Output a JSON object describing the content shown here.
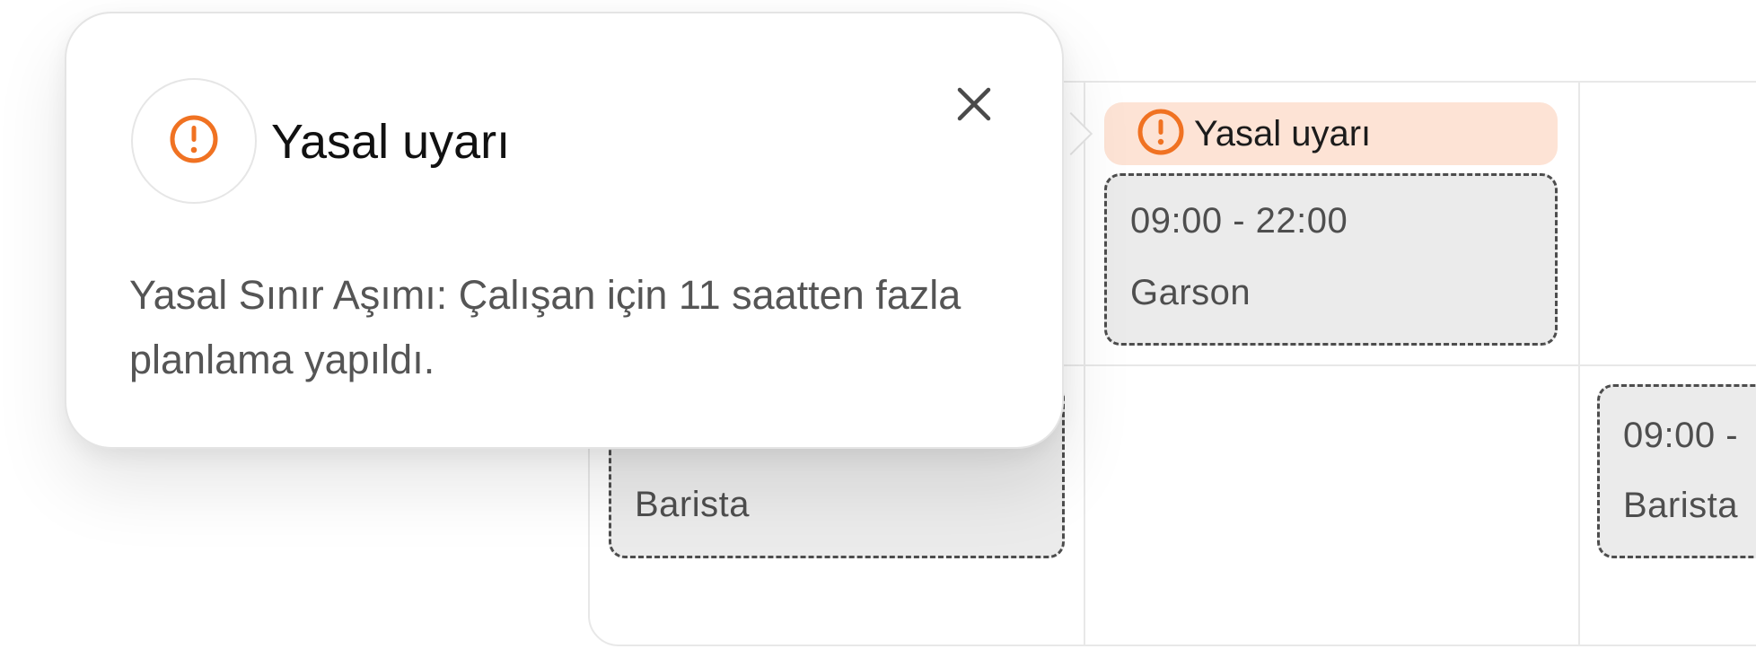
{
  "popover": {
    "title": "Yasal uyarı",
    "icon": "alert-circle-icon",
    "body": "Yasal Sınır Aşımı: Çalışan için 11 saatten fazla planlama yapıldı.",
    "close_icon": "close-icon"
  },
  "schedule": {
    "warning_chip": {
      "label": "Yasal uyarı",
      "icon": "alert-circle-icon"
    },
    "shifts": [
      {
        "time": "09:00 - 22:00",
        "role": "Garson"
      },
      {
        "time": "",
        "role": "Barista"
      },
      {
        "time": "09:00 -",
        "role": "Barista"
      }
    ]
  },
  "colors": {
    "warning_accent": "#f07222",
    "warning_chip_bg": "#fde3d5",
    "shift_bg": "#ebebeb",
    "shift_border": "#4d4d4d"
  }
}
